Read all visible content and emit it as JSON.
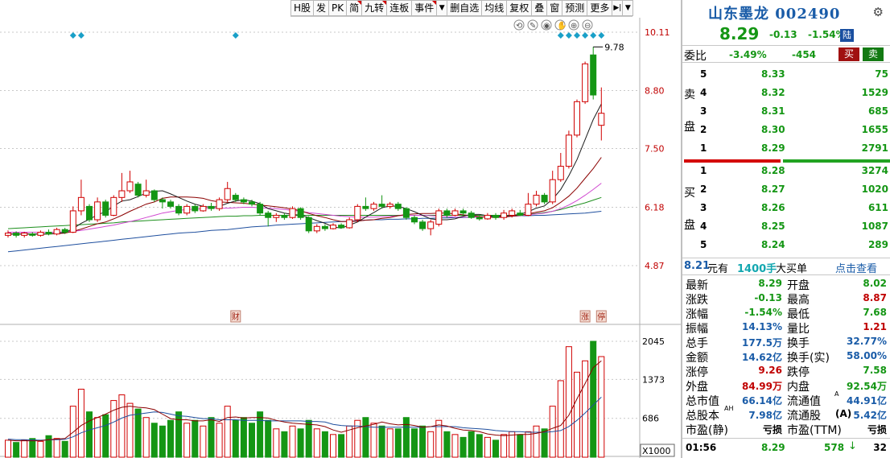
{
  "toolbar": {
    "buttons": [
      "H股",
      "发",
      "PK",
      "简",
      "九转",
      "连板",
      "事件",
      "",
      "删自选",
      "均线",
      "复权",
      "叠",
      "窗",
      "预测",
      "更多"
    ]
  },
  "chart_tools": [
    "lock-rotate-icon",
    "pen-icon",
    "eye-icon",
    "hand-icon",
    "zoom-in-icon",
    "zoom-out-icon"
  ],
  "colors": {
    "up": "#d00000",
    "down": "#149614",
    "ma5": "#1d1d1d",
    "ma10": "#8b0000",
    "ma20": "#d048d0",
    "ma60": "#1d8f1d",
    "ma120": "#1f4f9e",
    "bg": "#ffffff"
  },
  "chart_data": {
    "type": "candlestick",
    "price_axis": {
      "ticks": [
        "10.11",
        "8.80",
        "7.50",
        "6.18",
        "4.87"
      ],
      "ylim": [
        4.87,
        10.11
      ]
    },
    "volume_axis": {
      "ticks": [
        "2045",
        "1373",
        "686"
      ],
      "unit": "X1000"
    },
    "max_label": "9.78",
    "markers": [
      "财",
      "涨",
      "停"
    ],
    "candles": [
      {
        "o": 5.55,
        "c": 5.6,
        "h": 5.66,
        "l": 5.5,
        "v": 300
      },
      {
        "o": 5.6,
        "c": 5.55,
        "h": 5.64,
        "l": 5.5,
        "v": 260
      },
      {
        "o": 5.55,
        "c": 5.6,
        "h": 5.63,
        "l": 5.5,
        "v": 300
      },
      {
        "o": 5.58,
        "c": 5.55,
        "h": 5.62,
        "l": 5.52,
        "v": 330
      },
      {
        "o": 5.55,
        "c": 5.62,
        "h": 5.66,
        "l": 5.52,
        "v": 280
      },
      {
        "o": 5.62,
        "c": 5.58,
        "h": 5.68,
        "l": 5.55,
        "v": 380
      },
      {
        "o": 5.58,
        "c": 5.68,
        "h": 5.72,
        "l": 5.55,
        "v": 330
      },
      {
        "o": 5.68,
        "c": 5.62,
        "h": 5.72,
        "l": 5.58,
        "v": 280
      },
      {
        "o": 5.62,
        "c": 6.1,
        "h": 6.2,
        "l": 5.6,
        "v": 900
      },
      {
        "o": 6.1,
        "c": 6.4,
        "h": 6.8,
        "l": 6.0,
        "v": 1200
      },
      {
        "o": 6.2,
        "c": 5.9,
        "h": 6.25,
        "l": 5.85,
        "v": 800
      },
      {
        "o": 5.9,
        "c": 6.3,
        "h": 6.4,
        "l": 5.85,
        "v": 700
      },
      {
        "o": 6.3,
        "c": 6.0,
        "h": 6.35,
        "l": 5.95,
        "v": 750
      },
      {
        "o": 6.0,
        "c": 6.4,
        "h": 6.45,
        "l": 5.98,
        "v": 1000
      },
      {
        "o": 6.4,
        "c": 6.55,
        "h": 6.95,
        "l": 6.3,
        "v": 1100
      },
      {
        "o": 6.55,
        "c": 6.75,
        "h": 7.0,
        "l": 6.5,
        "v": 950
      },
      {
        "o": 6.7,
        "c": 6.45,
        "h": 6.75,
        "l": 6.4,
        "v": 850
      },
      {
        "o": 6.45,
        "c": 6.55,
        "h": 6.8,
        "l": 6.4,
        "v": 700
      },
      {
        "o": 6.55,
        "c": 6.35,
        "h": 6.58,
        "l": 6.3,
        "v": 600
      },
      {
        "o": 6.35,
        "c": 6.3,
        "h": 6.4,
        "l": 6.15,
        "v": 550
      },
      {
        "o": 6.3,
        "c": 6.2,
        "h": 6.35,
        "l": 6.15,
        "v": 650
      },
      {
        "o": 6.2,
        "c": 6.05,
        "h": 6.25,
        "l": 6.0,
        "v": 800
      },
      {
        "o": 6.05,
        "c": 6.2,
        "h": 6.25,
        "l": 6.0,
        "v": 600
      },
      {
        "o": 6.2,
        "c": 6.1,
        "h": 6.25,
        "l": 6.05,
        "v": 650
      },
      {
        "o": 6.1,
        "c": 6.2,
        "h": 6.25,
        "l": 6.08,
        "v": 550
      },
      {
        "o": 6.2,
        "c": 6.15,
        "h": 6.28,
        "l": 6.1,
        "v": 700
      },
      {
        "o": 6.15,
        "c": 6.35,
        "h": 6.4,
        "l": 6.1,
        "v": 600
      },
      {
        "o": 6.35,
        "c": 6.6,
        "h": 6.75,
        "l": 6.3,
        "v": 900
      },
      {
        "o": 6.45,
        "c": 6.35,
        "h": 6.5,
        "l": 6.3,
        "v": 650
      },
      {
        "o": 6.35,
        "c": 6.3,
        "h": 6.4,
        "l": 6.25,
        "v": 700
      },
      {
        "o": 6.3,
        "c": 6.25,
        "h": 6.35,
        "l": 6.2,
        "v": 600
      },
      {
        "o": 6.25,
        "c": 6.05,
        "h": 6.3,
        "l": 6.0,
        "v": 800
      },
      {
        "o": 6.05,
        "c": 5.95,
        "h": 6.1,
        "l": 5.75,
        "v": 650
      },
      {
        "o": 5.95,
        "c": 6.0,
        "h": 6.05,
        "l": 5.85,
        "v": 500
      },
      {
        "o": 6.0,
        "c": 5.95,
        "h": 6.05,
        "l": 5.9,
        "v": 450
      },
      {
        "o": 5.95,
        "c": 6.15,
        "h": 6.2,
        "l": 5.92,
        "v": 550
      },
      {
        "o": 6.15,
        "c": 5.95,
        "h": 6.18,
        "l": 5.9,
        "v": 500
      },
      {
        "o": 5.95,
        "c": 5.65,
        "h": 5.98,
        "l": 5.6,
        "v": 650
      },
      {
        "o": 5.65,
        "c": 5.75,
        "h": 5.8,
        "l": 5.6,
        "v": 500
      },
      {
        "o": 5.75,
        "c": 5.7,
        "h": 5.8,
        "l": 5.65,
        "v": 450
      },
      {
        "o": 5.7,
        "c": 5.78,
        "h": 5.82,
        "l": 5.68,
        "v": 400
      },
      {
        "o": 5.78,
        "c": 5.72,
        "h": 5.82,
        "l": 5.7,
        "v": 400
      },
      {
        "o": 5.72,
        "c": 5.9,
        "h": 5.95,
        "l": 5.7,
        "v": 550
      },
      {
        "o": 5.9,
        "c": 6.2,
        "h": 6.25,
        "l": 5.85,
        "v": 650
      },
      {
        "o": 6.2,
        "c": 6.15,
        "h": 6.4,
        "l": 6.1,
        "v": 700
      },
      {
        "o": 6.15,
        "c": 6.25,
        "h": 6.3,
        "l": 6.1,
        "v": 600
      },
      {
        "o": 6.25,
        "c": 6.2,
        "h": 6.45,
        "l": 6.15,
        "v": 550
      },
      {
        "o": 6.2,
        "c": 6.25,
        "h": 6.3,
        "l": 6.15,
        "v": 500
      },
      {
        "o": 6.25,
        "c": 6.15,
        "h": 6.3,
        "l": 6.1,
        "v": 500
      },
      {
        "o": 6.15,
        "c": 5.95,
        "h": 6.18,
        "l": 5.9,
        "v": 700
      },
      {
        "o": 5.95,
        "c": 5.85,
        "h": 6.0,
        "l": 5.8,
        "v": 500
      },
      {
        "o": 5.85,
        "c": 5.7,
        "h": 5.9,
        "l": 5.65,
        "v": 550
      },
      {
        "o": 5.7,
        "c": 5.85,
        "h": 5.9,
        "l": 5.55,
        "v": 450
      },
      {
        "o": 5.8,
        "c": 6.1,
        "h": 6.15,
        "l": 5.75,
        "v": 650
      },
      {
        "o": 6.1,
        "c": 6.0,
        "h": 6.15,
        "l": 5.95,
        "v": 450
      },
      {
        "o": 6.0,
        "c": 6.1,
        "h": 6.15,
        "l": 5.98,
        "v": 400
      },
      {
        "o": 6.1,
        "c": 6.05,
        "h": 6.15,
        "l": 6.0,
        "v": 350
      },
      {
        "o": 6.05,
        "c": 5.95,
        "h": 6.1,
        "l": 5.92,
        "v": 450
      },
      {
        "o": 5.95,
        "c": 5.92,
        "h": 6.0,
        "l": 5.88,
        "v": 400
      },
      {
        "o": 5.92,
        "c": 6.0,
        "h": 6.05,
        "l": 5.9,
        "v": 350
      },
      {
        "o": 6.0,
        "c": 5.95,
        "h": 6.05,
        "l": 5.9,
        "v": 300
      },
      {
        "o": 5.95,
        "c": 6.05,
        "h": 6.12,
        "l": 5.9,
        "v": 400
      },
      {
        "o": 6.0,
        "c": 6.1,
        "h": 6.15,
        "l": 5.95,
        "v": 450
      },
      {
        "o": 6.05,
        "c": 6.0,
        "h": 6.12,
        "l": 5.98,
        "v": 400
      },
      {
        "o": 6.0,
        "c": 6.25,
        "h": 6.5,
        "l": 5.98,
        "v": 450
      },
      {
        "o": 6.25,
        "c": 6.45,
        "h": 6.55,
        "l": 6.2,
        "v": 550
      },
      {
        "o": 6.45,
        "c": 6.3,
        "h": 6.5,
        "l": 6.25,
        "v": 500
      },
      {
        "o": 6.3,
        "c": 6.8,
        "h": 7.0,
        "l": 6.25,
        "v": 900
      },
      {
        "o": 6.8,
        "c": 7.1,
        "h": 7.4,
        "l": 6.75,
        "v": 1350
      },
      {
        "o": 7.1,
        "c": 7.8,
        "h": 7.9,
        "l": 7.05,
        "v": 1950
      },
      {
        "o": 7.8,
        "c": 8.55,
        "h": 8.6,
        "l": 7.75,
        "v": 1500
      },
      {
        "o": 8.55,
        "c": 9.4,
        "h": 9.45,
        "l": 8.5,
        "v": 1700
      },
      {
        "o": 9.6,
        "c": 8.7,
        "h": 9.78,
        "l": 8.6,
        "v": 2045
      },
      {
        "o": 8.02,
        "c": 8.29,
        "h": 8.87,
        "l": 7.68,
        "v": 1775
      }
    ],
    "ma5": [
      5.58,
      5.58,
      5.58,
      5.58,
      5.58,
      5.58,
      5.6,
      5.61,
      5.7,
      5.82,
      5.91,
      6.01,
      6.08,
      6.21,
      6.32,
      6.35,
      6.42,
      6.5,
      6.54,
      6.55,
      6.48,
      6.4,
      6.32,
      6.25,
      6.2,
      6.18,
      6.2,
      6.27,
      6.32,
      6.35,
      6.32,
      6.26,
      6.15,
      6.1,
      6.05,
      6.02,
      6.0,
      5.95,
      5.88,
      5.82,
      5.74,
      5.71,
      5.78,
      5.85,
      5.96,
      6.06,
      6.17,
      6.21,
      6.2,
      6.15,
      6.08,
      6.0,
      5.92,
      5.9,
      5.9,
      5.92,
      5.98,
      6.02,
      6.02,
      5.99,
      5.98,
      5.98,
      6.0,
      6.02,
      6.08,
      6.16,
      6.21,
      6.36,
      6.58,
      6.89,
      7.25,
      7.7,
      8.15,
      8.5
    ],
    "ma10": [
      5.58,
      5.58,
      5.58,
      5.58,
      5.58,
      5.58,
      5.59,
      5.6,
      5.64,
      5.69,
      5.75,
      5.81,
      5.85,
      5.92,
      6.0,
      6.09,
      6.17,
      6.25,
      6.3,
      6.38,
      6.41,
      6.41,
      6.41,
      6.4,
      6.38,
      6.33,
      6.3,
      6.29,
      6.28,
      6.27,
      6.25,
      6.23,
      6.21,
      6.19,
      6.17,
      6.14,
      6.1,
      6.04,
      5.99,
      5.95,
      5.9,
      5.86,
      5.86,
      5.87,
      5.89,
      5.9,
      5.93,
      5.95,
      5.99,
      6.02,
      6.03,
      6.04,
      6.04,
      6.05,
      6.05,
      6.03,
      6.01,
      5.99,
      5.97,
      5.96,
      5.95,
      5.96,
      5.98,
      6.0,
      6.03,
      6.07,
      6.1,
      6.17,
      6.29,
      6.43,
      6.61,
      6.83,
      7.05,
      7.3
    ],
    "ma20": [
      5.62,
      5.62,
      5.62,
      5.62,
      5.62,
      5.62,
      5.62,
      5.63,
      5.64,
      5.66,
      5.69,
      5.72,
      5.75,
      5.78,
      5.82,
      5.86,
      5.9,
      5.95,
      6.0,
      6.05,
      6.08,
      6.11,
      6.13,
      6.14,
      6.15,
      6.16,
      6.16,
      6.16,
      6.17,
      6.18,
      6.18,
      6.17,
      6.16,
      6.15,
      6.13,
      6.11,
      6.09,
      6.06,
      6.04,
      6.02,
      6.0,
      5.98,
      5.97,
      5.96,
      5.96,
      5.96,
      5.97,
      5.98,
      5.99,
      6.0,
      6.0,
      6.0,
      5.99,
      5.98,
      5.97,
      5.96,
      5.96,
      5.96,
      5.96,
      5.96,
      5.96,
      5.97,
      5.98,
      5.99,
      6.01,
      6.03,
      6.05,
      6.09,
      6.15,
      6.23,
      6.33,
      6.45,
      6.58,
      6.72
    ],
    "ma60": [
      5.7,
      5.71,
      5.72,
      5.73,
      5.74,
      5.75,
      5.76,
      5.77,
      5.78,
      5.79,
      5.8,
      5.81,
      5.82,
      5.83,
      5.85,
      5.86,
      5.87,
      5.88,
      5.89,
      5.9,
      5.91,
      5.92,
      5.93,
      5.94,
      5.95,
      5.96,
      5.97,
      5.98,
      5.98,
      5.99,
      5.99,
      6.0,
      6.0,
      6.0,
      6.0,
      6.0,
      6.0,
      6.0,
      6.0,
      6.0,
      6.0,
      6.0,
      6.0,
      6.0,
      6.0,
      6.0,
      6.0,
      6.0,
      6.0,
      6.0,
      6.0,
      6.0,
      6.0,
      6.0,
      6.0,
      6.0,
      6.0,
      6.0,
      6.0,
      6.0,
      6.0,
      6.0,
      6.0,
      6.01,
      6.02,
      6.04,
      6.06,
      6.09,
      6.13,
      6.18,
      6.23,
      6.28,
      6.34,
      6.4
    ],
    "ma120": [
      5.18,
      5.2,
      5.22,
      5.24,
      5.26,
      5.28,
      5.3,
      5.32,
      5.34,
      5.36,
      5.38,
      5.4,
      5.42,
      5.44,
      5.46,
      5.48,
      5.5,
      5.52,
      5.54,
      5.56,
      5.58,
      5.6,
      5.61,
      5.62,
      5.64,
      5.66,
      5.67,
      5.68,
      5.7,
      5.72,
      5.74,
      5.75,
      5.76,
      5.78,
      5.79,
      5.8,
      5.81,
      5.82,
      5.83,
      5.84,
      5.85,
      5.86,
      5.87,
      5.88,
      5.89,
      5.9,
      5.9,
      5.91,
      5.91,
      5.92,
      5.92,
      5.93,
      5.93,
      5.94,
      5.94,
      5.95,
      5.95,
      5.96,
      5.96,
      5.97,
      5.97,
      5.98,
      5.98,
      5.99,
      5.99,
      6.0,
      6.0,
      6.01,
      6.02,
      6.03,
      6.04,
      6.05,
      6.07,
      6.09
    ],
    "vol_ma5": [
      300,
      290,
      290,
      290,
      290,
      310,
      320,
      330,
      440,
      560,
      640,
      700,
      760,
      830,
      880,
      900,
      880,
      870,
      840,
      760,
      680,
      660,
      660,
      640,
      640,
      660,
      630,
      700,
      710,
      690,
      700,
      700,
      690,
      650,
      620,
      600,
      590,
      580,
      570,
      540,
      480,
      440,
      480,
      520,
      550,
      580,
      620,
      590,
      570,
      580,
      560,
      530,
      540,
      570,
      550,
      510,
      480,
      470,
      450,
      410,
      390,
      380,
      390,
      400,
      400,
      420,
      450,
      510,
      560,
      740,
      1030,
      1300,
      1580,
      1700
    ],
    "vol_ma10": [
      320,
      310,
      310,
      305,
      300,
      305,
      310,
      315,
      360,
      430,
      480,
      520,
      560,
      620,
      690,
      740,
      760,
      780,
      800,
      790,
      760,
      730,
      720,
      700,
      680,
      680,
      660,
      660,
      660,
      650,
      650,
      650,
      640,
      640,
      640,
      640,
      640,
      630,
      630,
      620,
      580,
      560,
      550,
      550,
      540,
      530,
      530,
      530,
      530,
      530,
      530,
      530,
      540,
      540,
      540,
      540,
      520,
      510,
      500,
      490,
      470,
      460,
      450,
      450,
      440,
      440,
      440,
      450,
      470,
      540,
      650,
      780,
      920,
      1060
    ]
  },
  "header": {
    "stock_name": "山东墨龙",
    "stock_code": "002490",
    "price": "8.29",
    "change": "-0.13",
    "change_pct": "-1.54%",
    "exchange": "陆"
  },
  "webi": {
    "label": "委比",
    "pct": "-3.49%",
    "diff": "-454",
    "buy": "买",
    "sell": "卖"
  },
  "sell_book": {
    "side_label": [
      "卖",
      "盘"
    ],
    "rows": [
      {
        "level": "5",
        "price": "8.33",
        "vol": "75"
      },
      {
        "level": "4",
        "price": "8.32",
        "vol": "1529"
      },
      {
        "level": "3",
        "price": "8.31",
        "vol": "685"
      },
      {
        "level": "2",
        "price": "8.30",
        "vol": "1655"
      },
      {
        "level": "1",
        "price": "8.29",
        "vol": "2791"
      }
    ]
  },
  "buy_book": {
    "side_label": [
      "买",
      "盘"
    ],
    "rows": [
      {
        "level": "1",
        "price": "8.28",
        "vol": "3274"
      },
      {
        "level": "2",
        "price": "8.27",
        "vol": "1020"
      },
      {
        "level": "3",
        "price": "8.26",
        "vol": "611"
      },
      {
        "level": "4",
        "price": "8.25",
        "vol": "1087"
      },
      {
        "level": "5",
        "price": "8.24",
        "vol": "289"
      }
    ]
  },
  "big_buy": {
    "price": "8.21",
    "unit": "元有",
    "vol": "1400手",
    "label": "大买单",
    "link": "点击查看"
  },
  "stats": [
    {
      "l1": "最新",
      "v1": "8.29",
      "c1": "#149614",
      "l2": "开盘",
      "v2": "8.02",
      "c2": "#149614"
    },
    {
      "l1": "涨跌",
      "v1": "-0.13",
      "c1": "#149614",
      "l2": "最高",
      "v2": "8.87",
      "c2": "#c00000"
    },
    {
      "l1": "涨幅",
      "v1": "-1.54%",
      "c1": "#149614",
      "l2": "最低",
      "v2": "7.68",
      "c2": "#149614"
    },
    {
      "l1": "振幅",
      "v1": "14.13%",
      "c1": "#1a5ca8",
      "l2": "量比",
      "v2": "1.21",
      "c2": "#c00000"
    },
    {
      "l1": "总手",
      "v1": "177.5万",
      "c1": "#1a5ca8",
      "l2": "换手",
      "v2": "32.77%",
      "c2": "#1a5ca8"
    },
    {
      "l1": "金额",
      "v1": "14.62亿",
      "c1": "#1a5ca8",
      "l2": "换手(实)",
      "v2": "58.00%",
      "c2": "#1a5ca8"
    },
    {
      "l1": "涨停",
      "v1": "9.26",
      "c1": "#c00000",
      "l2": "跌停",
      "v2": "7.58",
      "c2": "#149614"
    },
    {
      "l1": "外盘",
      "v1": "84.99万",
      "c1": "#c00000",
      "l2": "内盘",
      "v2": "92.54万",
      "c2": "#149614"
    },
    {
      "l1": "总市值",
      "v1": "66.14亿",
      "c1": "#1a5ca8",
      "l2": "流通值",
      "v2": "44.91亿",
      "c2": "#1a5ca8"
    },
    {
      "l1": "总股本",
      "v1": "7.98亿",
      "c1": "#1a5ca8",
      "l2": "流通股",
      "v2": "5.42亿",
      "c2": "#1a5ca8"
    },
    {
      "l1": "市盈(静)",
      "v1": "亏损",
      "c1": "#000000",
      "l2": "市盈(TTM)",
      "v2": "亏损",
      "c2": "#000000"
    }
  ],
  "stats_marks": {
    "ah": "AH",
    "a_sup": "A",
    "a_bracket": "(A)"
  },
  "tick": {
    "time": "01:56",
    "price": "8.29",
    "vol": "578",
    "arrow": "↓",
    "n": "32"
  }
}
